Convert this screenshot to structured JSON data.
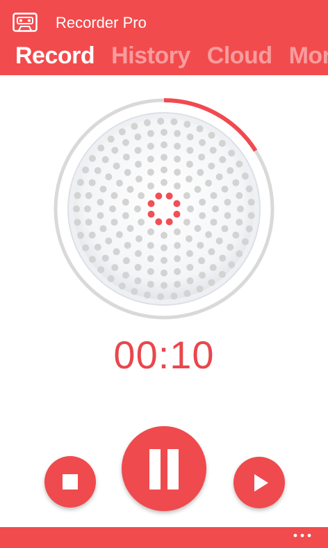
{
  "app": {
    "title": "Recorder Pro",
    "accent_color": "#f24b4d",
    "icon": "cassette-icon"
  },
  "tabs": [
    {
      "label": "Record",
      "active": true
    },
    {
      "label": "History",
      "active": false
    },
    {
      "label": "Cloud",
      "active": false
    },
    {
      "label": "More",
      "active": false
    }
  ],
  "recording": {
    "timer": "00:10",
    "progress": 0.16
  },
  "controls": {
    "stop_icon": "stop-icon",
    "pause_icon": "pause-icon",
    "play_icon": "play-icon"
  },
  "appbar": {
    "more_icon": "ellipsis-icon"
  }
}
